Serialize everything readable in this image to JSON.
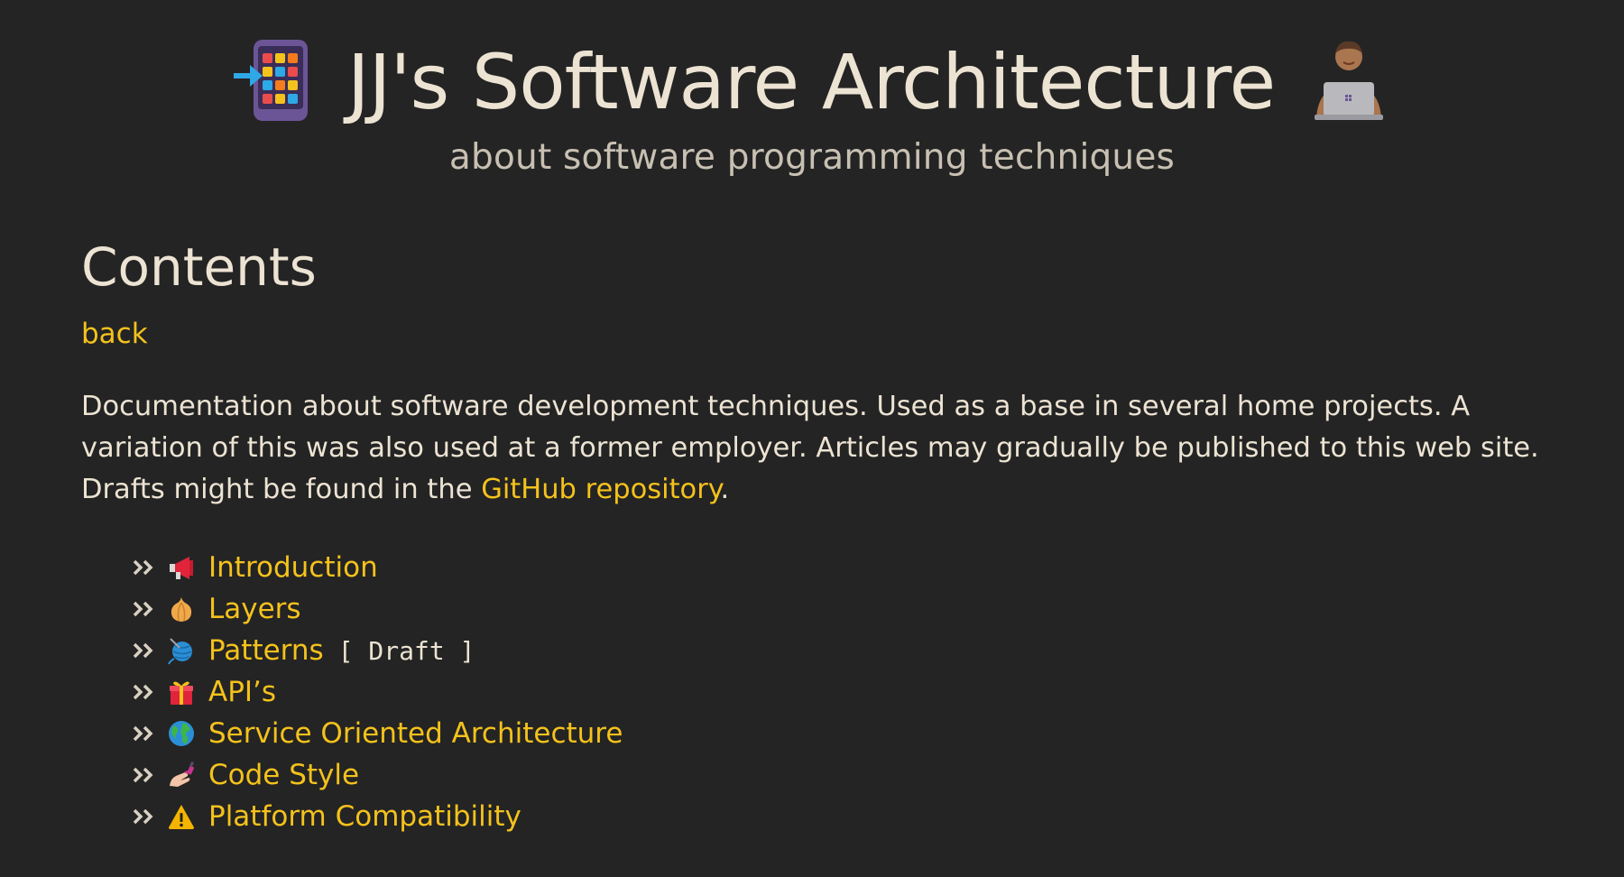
{
  "header": {
    "title": "JJ's Software Architecture",
    "tagline": "about software programming techniques",
    "left_icon": "mobile-apps-icon",
    "right_icon": "person-laptop-icon"
  },
  "main": {
    "heading": "Contents",
    "back_label": "back",
    "intro": {
      "text_before": "Documentation about software development techniques. Used as a base in several home projects. A variation of this was also used at a former employer. Articles may gradually be published to this web site. Drafts might be found in the ",
      "link_label": "GitHub repository",
      "text_after": "."
    },
    "toc": [
      {
        "label": "Introduction",
        "icon": "megaphone-icon",
        "tag": ""
      },
      {
        "label": "Layers",
        "icon": "onion-icon",
        "tag": ""
      },
      {
        "label": "Patterns",
        "icon": "yarn-icon",
        "tag": "[ Draft ]"
      },
      {
        "label": "API’s",
        "icon": "gift-icon",
        "tag": ""
      },
      {
        "label": "Service Oriented Architecture",
        "icon": "globe-icon",
        "tag": ""
      },
      {
        "label": "Code Style",
        "icon": "nail-polish-icon",
        "tag": ""
      },
      {
        "label": "Platform Compatibility",
        "icon": "warning-icon",
        "tag": ""
      }
    ]
  },
  "colors": {
    "background": "#242424",
    "text": "#ece3d3",
    "link": "#f4c21c"
  }
}
